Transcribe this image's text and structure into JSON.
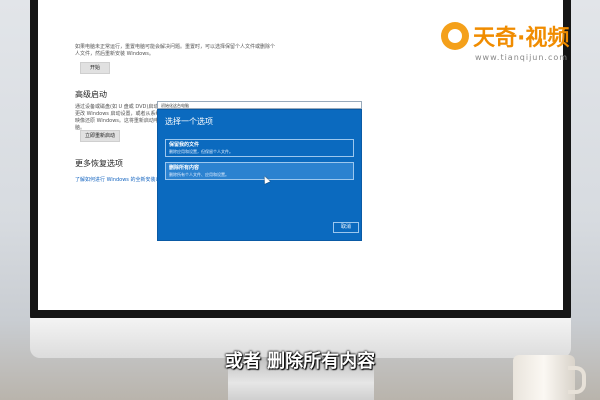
{
  "logo": {
    "text": "天奇·视频",
    "url": "www.tianqijun.com"
  },
  "settings": {
    "reset_description": "如果电脑未正常运行，重置电脑可能会解决问题。重置时，可以选择保留个人文件或删除个人文件，然后重新安装 Windows。",
    "start_button": "开始",
    "advanced_startup_heading": "高级启动",
    "advanced_startup_description": "通过设备或磁盘(如 U 盘或 DVD)启动，更改 Windows 启动设置，或者从系统映像还原 Windows。这将重新启动电脑。",
    "restart_now_button": "立即重新启动",
    "more_options_heading": "更多恢复选项",
    "more_options_link": "了解如何进行 Windows 的全新安装以便开始"
  },
  "dialog": {
    "window_title": "初始化这台电脑",
    "heading": "选择一个选项",
    "options": [
      {
        "title": "保留我的文件",
        "description": "删除应用和设置，但保留个人文件。"
      },
      {
        "title": "删除所有内容",
        "description": "删除所有个人文件、应用和设置。"
      }
    ],
    "cancel_button": "取消"
  },
  "subtitle": "或者 删除所有内容",
  "colors": {
    "dialog_blue": "#0b6abf",
    "logo_orange": "#f08c00"
  }
}
